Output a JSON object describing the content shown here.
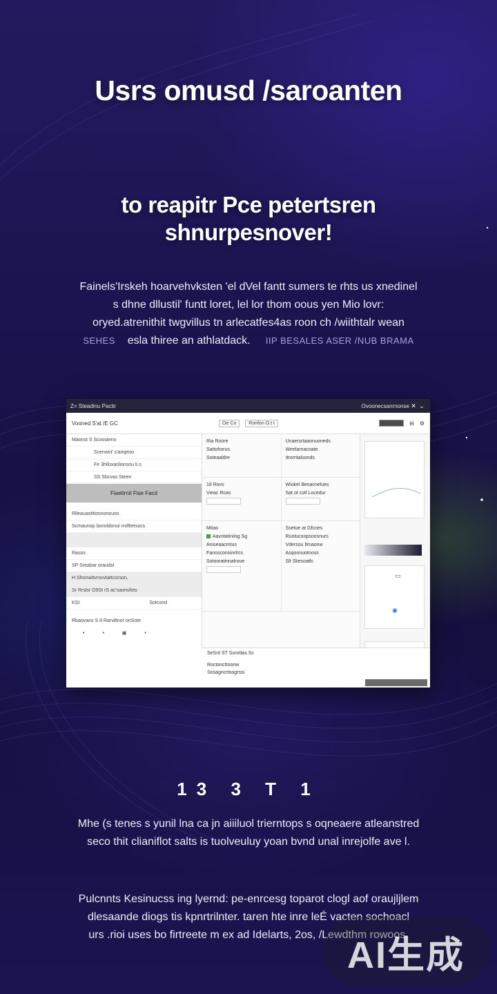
{
  "hero": {
    "title": "Usrs omusd /saroanten",
    "subtitle_line1": "to reapitr Pce petertsren",
    "subtitle_line2": "shnurpesnover!"
  },
  "intro": {
    "line1": "Fainels'Irskeh hoarvehvksten 'el dVel fantt sumers te rhts us xnedinel",
    "line2": "s dhne dllustil' funtt loret, lel lor thom oous yen Mio lovr:",
    "line3": "oryed.atrenithit twgvillus tn arlecatfes4as roon ch /wiithtalr wean",
    "line4_left": "SEHES",
    "line4_mid": "esla thiree an athlatdack.",
    "line4_right": "IIP BESALES ASER /NUB BRAMA"
  },
  "app": {
    "window_title": "Z= Steadinu Pacitr",
    "window_right": "Ovoonecsanrnonse",
    "toolbar_left": "Vooned S'at /E GC",
    "toolbar_box1": "Oe  Co",
    "toolbar_box2": "Ronfon  O.t t",
    "left_items": [
      "Maonst    S  Scoosteno",
      "Scenwst' s'anqeoo",
      "Fir 3hlloxaslionsou ti.s",
      "SS  Sbcvas Steen"
    ],
    "left_selected": "Fiaetirnit Fise Facd",
    "left_items_2": [
      "Rlleauastitiosnonouos",
      "Scmauriop laxrotdonoi rrofttetsocs"
    ],
    "left_items_3": [
      "Rasos",
      "SP  Sreabar oraudst"
    ],
    "left_items_4": [
      "H Shonwttvrovvtattcorson,",
      "Sr Rrslsr O9St rS ac'saonsfots"
    ],
    "left_footer_a": "KSI",
    "left_footer_b": "Sotcond",
    "left_bottom_title": "Rbaovans S 8 Rarviltnor onSote",
    "mid_rows": [
      [
        "Ria Roore",
        "Unaersrtaaonuoneds"
      ],
      [
        "Sattohorus",
        "Weelarnacoate"
      ],
      [
        "Soteaaldre",
        "Itrorntalsonds"
      ],
      [
        "18 Rovs",
        "Wiokel Besacnelues"
      ],
      [
        "Vieac Rcas",
        "Sat ot cotl Locedur"
      ],
      [
        "Mtiao",
        "Ssetue at Gfcnes"
      ],
      [
        "Aavotatiniisg  Sg",
        "Ruotucoopsoosnurs"
      ],
      [
        "Aniseaacmtus",
        "Vdersou ltmaonw"
      ],
      [
        "Fanosconoinrlrcs",
        "Asqoonuotnoss"
      ],
      [
        "Sotooratinnalroue",
        "Slt  Skesoatlc"
      ]
    ],
    "bottom_row1": "SeSnt  ST      Sorottas  Sc",
    "bottom_row2": "Roctoncttoonw",
    "bottom_row3": "Sosagncrtoogrssi."
  },
  "stats": "13 3 T 1",
  "body1": {
    "line1": "Mhe (s tenes s  yunil lna ca jn aiiiluol trierntops s oqneaere atleanstred",
    "line2": "seco thit clianiflot salts is tuolveuluy  yoan bvnd unal inrejolfe ave l."
  },
  "body2": {
    "line1": "Pulcnnts Kesinucss ing lyernd:   pe-enrcesg toparot clogl aof oraujljlem",
    "line2": "dlesaande diogs tis kpnrtrilnter.  taren hte inre leÉ  vacten sochoacl",
    "line3": "urs .rioi uses bo firtreete m ex ad Idelarts, 2os,  /Lewdthm rowoos."
  },
  "watermark": "AI生成"
}
